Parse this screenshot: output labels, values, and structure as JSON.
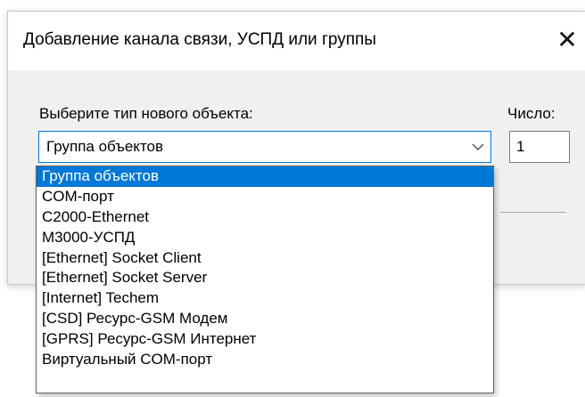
{
  "dialog": {
    "title": "Добавление канала связи, УСПД или группы",
    "close_glyph": "✕"
  },
  "form": {
    "type_label": "Выберите тип нового объекта:",
    "count_label": "Число:",
    "selected_type": "Группа объектов",
    "count_value": "1"
  },
  "dropdown": {
    "options": [
      "Группа объектов",
      "COM-порт",
      "C2000-Ethernet",
      "М3000-УСПД",
      "[Ethernet] Socket Client",
      "[Ethernet] Socket Server",
      "[Internet] Techem",
      "[CSD] Ресурс-GSM Модем",
      "[GPRS] Ресурс-GSM Интернет",
      "Виртуальный COM-порт"
    ],
    "highlighted_index": 0
  },
  "colors": {
    "accent": "#0078d7",
    "dialog_bg": "#f0f0f0",
    "titlebar_bg": "#ffffff"
  },
  "icons": [
    "close-icon",
    "chevron-down-icon"
  ]
}
